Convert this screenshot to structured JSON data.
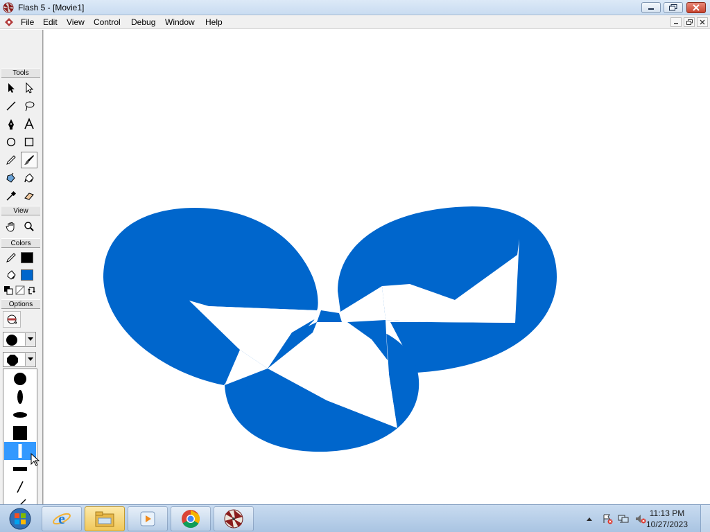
{
  "window": {
    "title": "Flash 5 - [Movie1]",
    "minimize_label": "–",
    "maximize_label": "❐",
    "close_label": "✕"
  },
  "menubar": {
    "items": [
      "File",
      "Edit",
      "View",
      "Control",
      "Debug",
      "Window",
      "Help"
    ]
  },
  "toolbox": {
    "sections": {
      "tools": "Tools",
      "view": "View",
      "colors": "Colors",
      "options": "Options"
    },
    "tools": [
      "arrow-tool",
      "subselect-tool",
      "line-tool",
      "lasso-tool",
      "pen-tool",
      "text-tool",
      "oval-tool",
      "rectangle-tool",
      "pencil-tool",
      "brush-tool",
      "ink-bottle-tool",
      "paint-bucket-tool",
      "eyedropper-tool",
      "eraser-tool"
    ],
    "selected_tool": "brush-tool",
    "colors": {
      "stroke": "#000000",
      "fill": "#0066cc"
    },
    "brush_shapes": [
      "circle-large",
      "ellipse-vertical",
      "ellipse-horizontal",
      "square",
      "rect-vertical",
      "rect-horizontal",
      "diagonal-thin",
      "diagonal-medium",
      "diagonal-long"
    ],
    "selected_brush_shape": "rect-vertical"
  },
  "stage": {
    "artwork_color": "#0066cc",
    "background": "#ffffff"
  },
  "taskbar": {
    "pinned": [
      "internet-explorer-icon",
      "file-explorer-icon",
      "media-player-icon",
      "chrome-icon",
      "flash-icon"
    ],
    "time": "11:13 PM",
    "date": "10/27/2023"
  }
}
